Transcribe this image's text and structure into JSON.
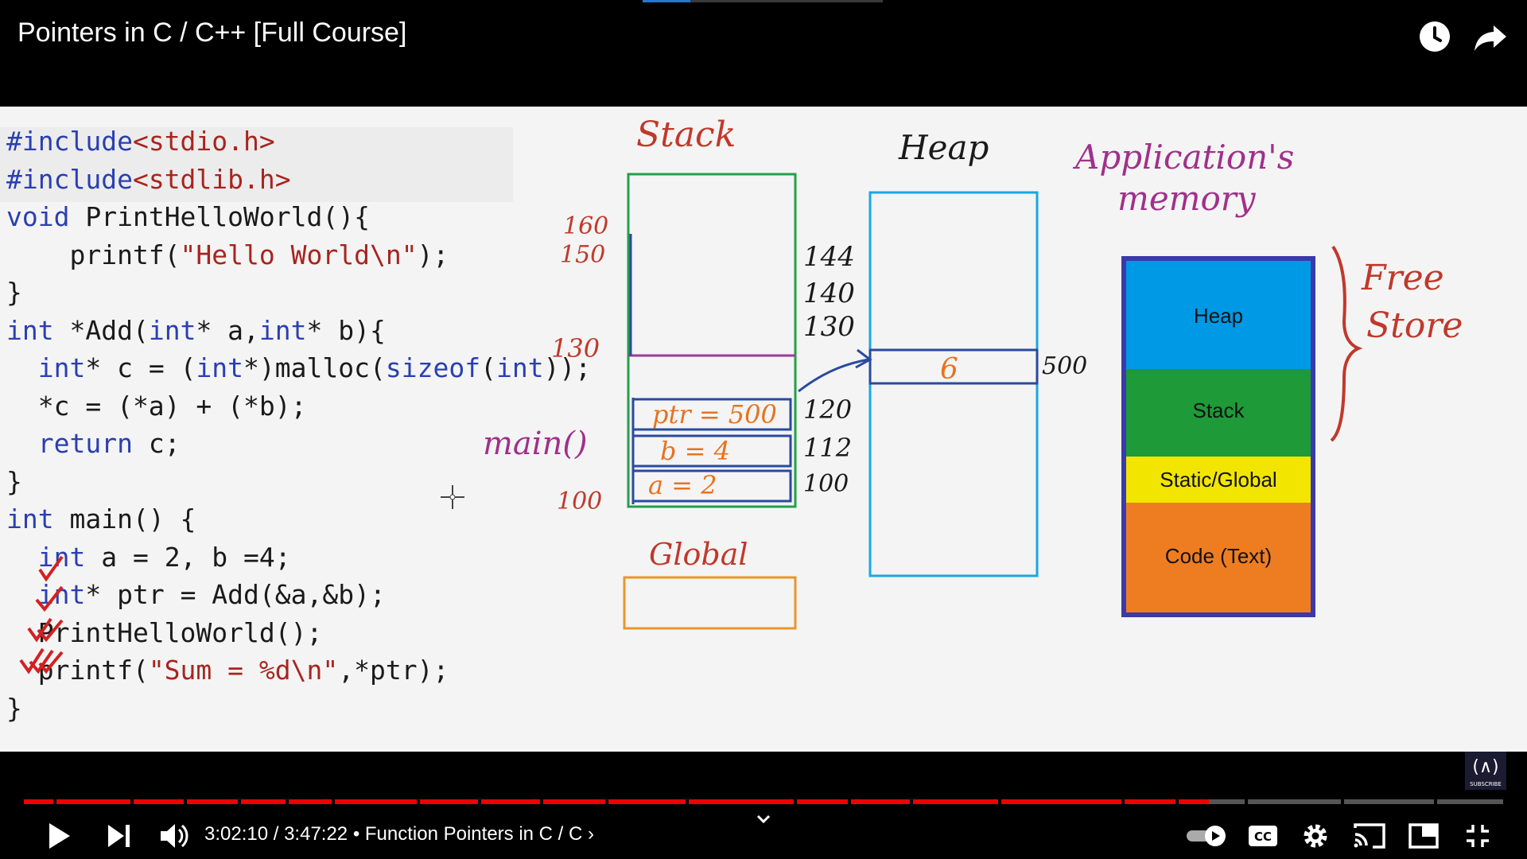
{
  "header": {
    "title": "Pointers in C / C++ [Full Course]",
    "watch_later_icon": "clock-icon",
    "share_icon": "share-arrow-icon"
  },
  "code": {
    "lines": [
      "#include<stdio.h>",
      "#include<stdlib.h>",
      "void PrintHelloWorld(){",
      "    printf(\"Hello World\\n\");",
      "}",
      "int *Add(int* a,int* b){",
      "  int* c = (int*)malloc(sizeof(int));",
      "  *c = (*a) + (*b);",
      "  return c;",
      "}",
      "int main() {",
      "  int a = 2, b =4;",
      "  int* ptr = Add(&a,&b);",
      "  PrintHelloWorld();",
      "  printf(\"Sum = %d\\n\",*ptr);",
      "}"
    ]
  },
  "diagram": {
    "stack_title": "Stack",
    "heap_title": "Heap",
    "global_title": "Global",
    "app_memory_title": "Application's",
    "app_memory_subtitle": "memory",
    "free_store_line1": "Free",
    "free_store_line2": "Store",
    "main_label": "main()",
    "stack_left_addresses": [
      "160",
      "150",
      "130",
      "100"
    ],
    "stack_right_addresses": [
      "144",
      "140",
      "130",
      "120",
      "112",
      "100"
    ],
    "stack_cells": [
      "ptr = 500",
      "b = 4",
      "a = 2"
    ],
    "heap_cell_value": "6",
    "heap_cell_address": "500",
    "memory_segments": [
      {
        "label": "Heap",
        "color": "#0099e6"
      },
      {
        "label": "Stack",
        "color": "#1e9a38"
      },
      {
        "label": "Static/Global",
        "color": "#f2e600"
      },
      {
        "label": "Code (Text)",
        "color": "#ee7d22"
      }
    ]
  },
  "player": {
    "current_time": "3:02:10",
    "duration": "3:47:22",
    "chapter": "Function Pointers in C / C",
    "time_text": "3:02:10 / 3:47:22 • Function Pointers in C / C ›",
    "progress": 0.801,
    "logo_text": "SUBSCRIBE",
    "icons": [
      "play-icon",
      "next-icon",
      "volume-icon",
      "chevron-down-icon",
      "autoplay-toggle",
      "captions-icon",
      "settings-icon",
      "cast-icon",
      "miniplayer-icon",
      "exit-fullscreen-icon"
    ]
  }
}
